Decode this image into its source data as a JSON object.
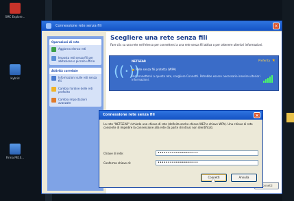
{
  "desktop": {
    "icons": [
      {
        "label": "SMC Explore..."
      },
      {
        "label": "Hybrid"
      },
      {
        "label": "Firma PE10..."
      }
    ]
  },
  "main_window": {
    "title": "Connessione rete senza fili",
    "left_pane": {
      "sections": [
        {
          "heading": "Operazioni di rete",
          "items": [
            "Aggiorna elenco reti",
            "Imposta reti senza fili per abitazione o piccolo ufficio"
          ]
        },
        {
          "heading": "Attività correlate",
          "items": [
            "Informazioni sulle reti senza fili",
            "Cambia l'ordine delle reti preferite",
            "Cambia impostazioni avanzate"
          ]
        }
      ]
    },
    "right_pane": {
      "heading": "Scegliere una rete senza fili",
      "description": "Fare clic su una rete nell'elenco per connettersi a una rete senza fili attiva o per ottenere ulteriori informazioni.",
      "network": {
        "name": "NETGEAR",
        "preferred": "Preferita",
        "security": "Rete senza fili protetta (WPA)",
        "info": "Per connettersi a questa rete, scegliere Connetti. Potrebbe essere necessario inserire ulteriori informazioni."
      },
      "connect_label": "Connetti"
    }
  },
  "key_dialog": {
    "title": "Connessione rete senza fili",
    "message": "La rete \"NETGEAR\" richiede una chiave di rete (definita anche chiave WEP o chiave WPA). Una chiave di rete consente di impedire la connessione alla rete da parte di intrusi non identificati.",
    "key_label": "Chiave di rete:",
    "key_value": "••••••••••••••••••••",
    "confirm_label": "Conferma chiave di:",
    "confirm_value": "••••••••••••••••••••",
    "connect_button": "Connetti",
    "cancel_button": "Annulla"
  },
  "colors": {
    "titlebar": "#1452c4",
    "left_pane": "#7fa3e6",
    "network_selected": "#3a6cc8"
  }
}
